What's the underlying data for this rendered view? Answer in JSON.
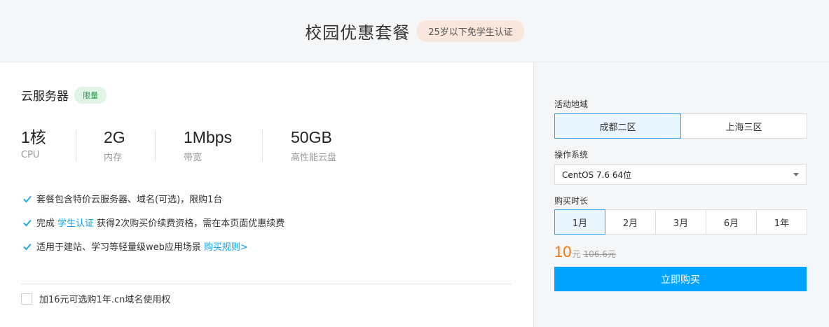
{
  "header": {
    "title": "校园优惠套餐",
    "badge": "25岁以下免学生认证"
  },
  "product": {
    "name": "云服务器",
    "badge": "限量"
  },
  "specs": [
    {
      "value": "1核",
      "label": "CPU"
    },
    {
      "value": "2G",
      "label": "内存"
    },
    {
      "value": "1Mbps",
      "label": "带宽"
    },
    {
      "value": "50GB",
      "label": "高性能云盘"
    }
  ],
  "features": {
    "f1": "套餐包含特价云服务器、域名(可选)，限购1台",
    "f2_prefix": "完成",
    "f2_link": "学生认证",
    "f2_suffix": "获得2次购买价续费资格，需在本页面优惠续费",
    "f3_text": "适用于建站、学习等轻量级web应用场景",
    "f3_link": "购买规则>"
  },
  "addon": {
    "label": "加16元可选购1年.cn域名使用权"
  },
  "region": {
    "label": "活动地域",
    "options": [
      "成都二区",
      "上海三区"
    ],
    "selected": "成都二区"
  },
  "os": {
    "label": "操作系统",
    "value": "CentOS 7.6 64位"
  },
  "duration": {
    "label": "购买时长",
    "options": [
      "1月",
      "2月",
      "3月",
      "6月",
      "1年"
    ],
    "selected": "1月"
  },
  "price": {
    "value": "10",
    "unit": "元",
    "original": "106.6元"
  },
  "buy_label": "立即购买",
  "colors": {
    "accent": "#00a4ff",
    "price": "#ff7200",
    "green_badge": "#1e9a48",
    "orange_badge_bg": "#f9e6dc"
  },
  "icons": {
    "feature_bullet": "check-icon",
    "select_caret": "caret-down-icon"
  }
}
